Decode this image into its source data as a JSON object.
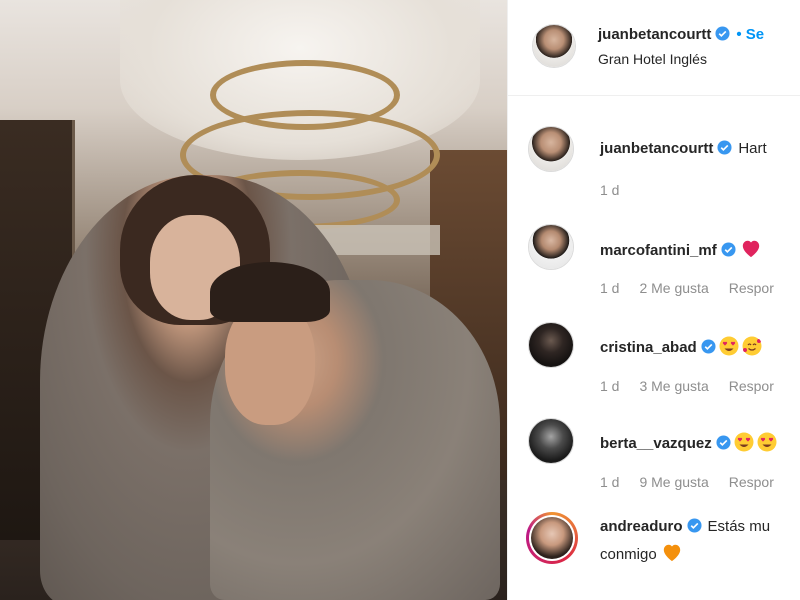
{
  "post": {
    "username": "juanbetancourtt",
    "follow_label": "• Se",
    "location": "Gran Hotel Inglés"
  },
  "comments": [
    {
      "username": "juanbetancourtt",
      "text": "Hart",
      "time": "1 d",
      "likes": "",
      "reply": ""
    },
    {
      "username": "marcofantini_mf",
      "text": "",
      "time": "1 d",
      "likes": "2 Me gusta",
      "reply": "Respor"
    },
    {
      "username": "cristina_abad",
      "text": "",
      "time": "1 d",
      "likes": "3 Me gusta",
      "reply": "Respor"
    },
    {
      "username": "berta__vazquez",
      "text": "",
      "time": "1 d",
      "likes": "9 Me gusta",
      "reply": "Respor"
    },
    {
      "username": "andreaduro",
      "text": "Estás mu",
      "text2": "conmigo",
      "time": "",
      "likes": "",
      "reply": ""
    }
  ],
  "icons": {
    "verified": "verified-badge-icon",
    "heart_red": "red-heart-emoji",
    "heart_orange": "orange-heart-emoji",
    "heart_eyes": "heart-eyes-emoji",
    "smiling_hearts": "smiling-face-with-hearts-emoji"
  },
  "colors": {
    "link_blue": "#0095f6",
    "verified_blue": "#3897f0",
    "meta_gray": "#8e8e8e"
  }
}
